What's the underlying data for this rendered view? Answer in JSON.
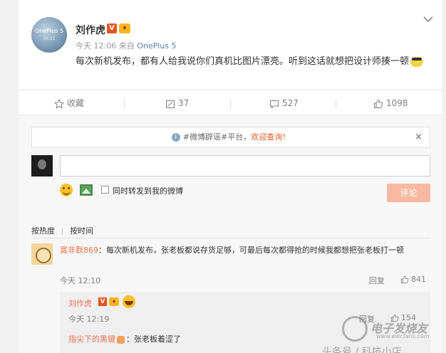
{
  "post": {
    "avatar_text": "OnePlus 5",
    "avatar_sub": "06.21",
    "username": "刘作虎",
    "vip_badge": "V",
    "level_badge": "💎",
    "time": "今天 12:06 来自",
    "device": "OnePlus 5",
    "text": "每次新机发布，都有人给我说你们真机比图片漂亮。听到这话就想把设计师揍一顿"
  },
  "actions": {
    "favorite": "收藏",
    "repost": "37",
    "comment": "527",
    "like": "1098"
  },
  "notice": {
    "before": "#微博辟谣#平台，",
    "highlight": "欢迎查询！",
    "close": "×"
  },
  "composer": {
    "checkbox_label": "同时转发到我的微博",
    "submit": "评论"
  },
  "sort": {
    "hot": "按热度",
    "time": "按时间"
  },
  "comments": [
    {
      "name": "寞非默869",
      "text": "：每次新机发布，张老板都说存货足够，可最后每次都得抢的时候我都想把张老板打一顿",
      "time": "今天 12:10",
      "reply": "回复",
      "likes": "841"
    }
  ],
  "sub_comments": [
    {
      "name": "刘作虎",
      "vip_badge": "V",
      "level_badge": "💎",
      "time": "今天 12:19",
      "reply": "回复",
      "likes": "154"
    },
    {
      "name": "指尖下的黑键",
      "text": "：张老板着涩了"
    }
  ],
  "watermark": {
    "title": "电子发烧友",
    "sub": "www.elecfans.com",
    "bottom": "头条号 / 科技小店"
  },
  "colors": {
    "accent": "#eb7350",
    "brand_orange": "#e8531f",
    "muted": "#808080"
  }
}
